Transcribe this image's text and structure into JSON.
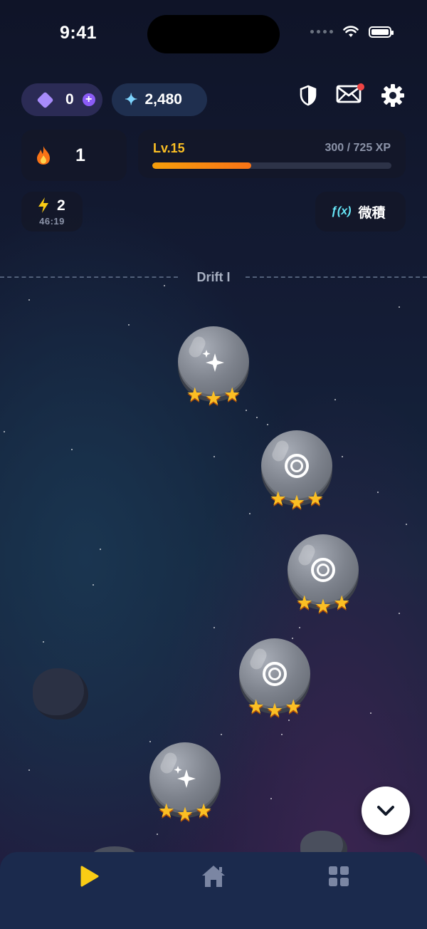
{
  "status_bar": {
    "time": "9:41"
  },
  "currency": {
    "gems": "0",
    "sparks": "2,480"
  },
  "streak": {
    "count": "1"
  },
  "level": {
    "label": "Lv.15",
    "xp": "300 / 725 XP",
    "progress": 0.414
  },
  "energy": {
    "count": "2",
    "timer": "46:19"
  },
  "course": {
    "icon_text": "ƒ(x)",
    "label": "微積"
  },
  "section": {
    "title": "Drift I"
  },
  "nodes": [
    {
      "icon": "sparkle-icon",
      "stars": 3
    },
    {
      "icon": "target-icon",
      "stars": 3
    },
    {
      "icon": "target-icon",
      "stars": 3
    },
    {
      "icon": "target-icon",
      "stars": 3
    },
    {
      "icon": "sparkle-icon",
      "stars": 3
    }
  ],
  "tabs": [
    {
      "name": "play",
      "icon": "play-icon",
      "active": true
    },
    {
      "name": "home",
      "icon": "home-icon",
      "active": false
    },
    {
      "name": "grid",
      "icon": "grid-icon",
      "active": false
    }
  ],
  "colors": {
    "accent": "#fbbf24",
    "progress": "#f59e0b",
    "background": "#141c35",
    "tabbar": "#1b2a4d"
  }
}
